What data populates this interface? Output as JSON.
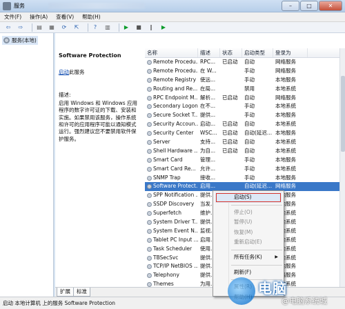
{
  "window": {
    "title": "服务",
    "controls": {
      "minimize": "–",
      "maximize": "□",
      "close": "✕"
    }
  },
  "menu": [
    "文件(F)",
    "操作(A)",
    "查看(V)",
    "帮助(H)"
  ],
  "toolbar": {
    "icons": [
      "back-arrow-icon",
      "forward-arrow-icon",
      "console-tree-icon",
      "properties-icon",
      "refresh-icon",
      "export-icon",
      "help-icon",
      "details-icon",
      "play-icon",
      "stop-icon",
      "pause-icon",
      "restart-icon"
    ],
    "glyphs": {
      "back": "⇦",
      "forward": "⇨",
      "tree": "▤",
      "props": "▦",
      "refresh": "⟳",
      "export": "⇱",
      "help": "?",
      "details": "▥",
      "play": "▶",
      "stop": "■",
      "pause": "‖",
      "restart": "▶"
    }
  },
  "tree": {
    "root_label": "服务(本地)"
  },
  "detail": {
    "service_name": "Software Protection",
    "start_link": "启动",
    "start_rest": "此服务",
    "desc_label": "描述:",
    "description": "启用 Windows 和 Windows 应用程序的数字许可证的下载、安装和实施。如果禁用该服务，操作系统和许可的应用程序可能以通知模式运行。强烈建议您不要禁用软件保护服务。"
  },
  "table": {
    "headers": [
      "名称",
      "描述",
      "状态",
      "启动类型",
      "登录为"
    ],
    "rows": [
      [
        "Remote Procedu...",
        "RPC...",
        "已启动",
        "自动",
        "网络服务"
      ],
      [
        "Remote Procedu...",
        "在 W...",
        "",
        "手动",
        "网络服务"
      ],
      [
        "Remote Registry",
        "使远...",
        "",
        "手动",
        "本地服务"
      ],
      [
        "Routing and Re...",
        "在局...",
        "",
        "禁用",
        "本地系统"
      ],
      [
        "RPC Endpoint M...",
        "解析...",
        "已启动",
        "自动",
        "网络服务"
      ],
      [
        "Secondary Logon",
        "在不...",
        "",
        "手动",
        "本地系统"
      ],
      [
        "Secure Socket T...",
        "提供...",
        "",
        "手动",
        "本地服务"
      ],
      [
        "Security Accoun...",
        "启动...",
        "已启动",
        "自动",
        "本地系统"
      ],
      [
        "Security Center",
        "WSC...",
        "已启动",
        "自动(延迟...",
        "本地服务"
      ],
      [
        "Server",
        "支持...",
        "已启动",
        "自动",
        "本地系统"
      ],
      [
        "Shell Hardware ...",
        "为自...",
        "已启动",
        "自动",
        "本地系统"
      ],
      [
        "Smart Card",
        "管理...",
        "",
        "手动",
        "本地服务"
      ],
      [
        "Smart Card Re...",
        "允许...",
        "",
        "手动",
        "本地系统"
      ],
      [
        "SNMP Trap",
        "接收...",
        "",
        "手动",
        "本地服务"
      ],
      [
        "Software Protect...",
        "启用...",
        "",
        "自动(延迟...",
        "网络服务"
      ],
      [
        "SPP Notification ...",
        "提供...",
        "",
        "手动",
        "本地服务"
      ],
      [
        "SSDP Discovery",
        "当发...",
        "",
        "手动",
        "本地服务"
      ],
      [
        "Superfetch",
        "维护...",
        "",
        "",
        "本地系统"
      ],
      [
        "System Driver T...",
        "提供...",
        "",
        "",
        "本地系统"
      ],
      [
        "System Event N...",
        "监视...",
        "",
        "",
        "本地系统"
      ],
      [
        "Tablet PC Input ...",
        "启用...",
        "",
        "",
        "本地系统"
      ],
      [
        "Task Scheduler",
        "使用...",
        "",
        "",
        "本地系统"
      ],
      [
        "TBSecSvc",
        "提供...",
        "",
        "",
        "本地系统"
      ],
      [
        "TCP/IP NetBIOS ...",
        "提供...",
        "",
        "",
        "本地服务"
      ],
      [
        "Telephony",
        "提供...",
        "",
        "",
        "网络服务"
      ],
      [
        "Themes",
        "为用...",
        "",
        "",
        "本地系统"
      ]
    ],
    "selected_index": 14
  },
  "context_menu": {
    "items": [
      {
        "label": "启动(S)",
        "state": "highlighted"
      },
      {
        "label": "停止(O)",
        "state": "disabled"
      },
      {
        "label": "暂停(U)",
        "state": "disabled"
      },
      {
        "label": "恢复(M)",
        "state": "disabled"
      },
      {
        "label": "重新启动(E)",
        "state": "disabled"
      },
      {
        "label": "所有任务(K)",
        "state": "normal",
        "submenu": "▶"
      },
      {
        "label": "刷新(F)",
        "state": "normal"
      },
      {
        "label": "属性(R)",
        "state": "normal"
      },
      {
        "label": "帮助(H)",
        "state": "normal"
      }
    ]
  },
  "tabs": [
    "扩展",
    "标准"
  ],
  "status": "启动 本地计算机 上的服务 Software Protection",
  "watermark": {
    "brand": "电脑",
    "sub": "@电脑系统城"
  },
  "colors": {
    "selection": "#3a78c8",
    "highlight_outline": "#d8332a",
    "link": "#0645ad"
  }
}
